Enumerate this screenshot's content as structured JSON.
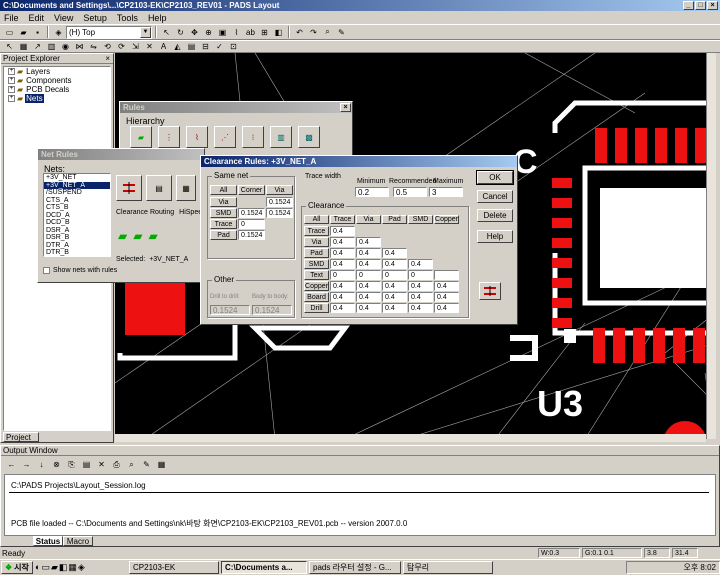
{
  "window": {
    "title": "C:\\Documents and Settings\\...\\CP2103-EK\\CP2103_REV01 - PADS Layout"
  },
  "menu": [
    "File",
    "Edit",
    "View",
    "Setup",
    "Tools",
    "Help"
  ],
  "toolbar": {
    "layer_value": "(H) Top"
  },
  "project_explorer": {
    "title": "Project Explorer",
    "items": [
      {
        "label": "Layers"
      },
      {
        "label": "Components"
      },
      {
        "label": "PCB Decals"
      },
      {
        "label": "Nets"
      }
    ],
    "tab": "Project"
  },
  "rules_window": {
    "title": "Rules",
    "hierarchy_label": "Hierarchy"
  },
  "net_rules": {
    "title": "Net Rules",
    "nets_label": "Nets:",
    "nets": [
      "+3V_NET",
      "+3V_NET_A",
      "/SUSPEND",
      "CTS_A",
      "CTS_B",
      "DCD_A",
      "DCD_B",
      "DSR_A",
      "DSR_B",
      "DTR_A",
      "DTR_B"
    ],
    "selected_index": 1,
    "buttons": [
      "Clearance",
      "Routing",
      "HiSpeed"
    ],
    "selected_label": "Selected:",
    "selected_value": "+3V_NET_A",
    "show_nets_label": "Show nets with rules"
  },
  "clearance": {
    "title": "Clearance Rules: +3V_NET_A",
    "same_net_label": "Same net",
    "same_net_cols": [
      "All",
      "Corner",
      "Via"
    ],
    "same_net_rows": [
      {
        "label": "Via",
        "values": [
          "",
          "0.1524"
        ]
      },
      {
        "label": "SMD",
        "values": [
          "0.1524",
          "0.1524"
        ]
      },
      {
        "label": "Trace",
        "values": [
          "0",
          ""
        ]
      },
      {
        "label": "Pad",
        "values": [
          "0.1524",
          ""
        ]
      }
    ],
    "other_label": "Other",
    "drill_to_drill_label": "Drill to drill:",
    "drill_to_drill_value": "0.1524",
    "body_to_body_label": "Body to body:",
    "body_to_body_value": "0.1524",
    "trace_width_label": "Trace width",
    "tw_headers": [
      "Minimum",
      "Recommended",
      "Maximum"
    ],
    "tw_values": [
      "0.2",
      "0.5",
      "3"
    ],
    "clearance_label": "Clearance",
    "grid_cols": [
      "All",
      "Trace",
      "Via",
      "Pad",
      "SMD",
      "Copper"
    ],
    "grid_rows": [
      {
        "label": "Trace",
        "values": [
          "0.4",
          "",
          "",
          "",
          ""
        ]
      },
      {
        "label": "Via",
        "values": [
          "0.4",
          "0.4",
          "",
          "",
          ""
        ]
      },
      {
        "label": "Pad",
        "values": [
          "0.4",
          "0.4",
          "0.4",
          "",
          ""
        ]
      },
      {
        "label": "SMD",
        "values": [
          "0.4",
          "0.4",
          "0.4",
          "0.4",
          ""
        ]
      },
      {
        "label": "Text",
        "values": [
          "0",
          "0",
          "0",
          "0",
          ""
        ]
      },
      {
        "label": "Copper",
        "values": [
          "0.4",
          "0.4",
          "0.4",
          "0.4",
          "0.4"
        ]
      },
      {
        "label": "Board",
        "values": [
          "0.4",
          "0.4",
          "0.4",
          "0.4",
          "0.4"
        ]
      },
      {
        "label": "Drill",
        "values": [
          "0.4",
          "0.4",
          "0.4",
          "0.4",
          "0.4"
        ]
      }
    ],
    "buttons": [
      "OK",
      "Cancel",
      "Delete",
      "Help"
    ]
  },
  "canvas": {
    "component_ref": "U3",
    "pin_label": "C"
  },
  "output": {
    "title": "Output Window",
    "lines": [
      "C:\\PADS Projects\\Layout_Session.log",
      "PCB file loaded -- C:\\Documents and Settings\\nk\\바탕 화면\\CP2103-EK\\CP2103_REV01.pcb -- version 2007.0.0"
    ],
    "tabs": [
      "Status",
      "Macro"
    ]
  },
  "status": {
    "left": "Ready",
    "w": "W:0.3",
    "g": "G:0.1 0.1",
    "x": "3.8",
    "y": "31.4"
  },
  "taskbar": {
    "start": "시작",
    "tasks": [
      "CP2103-EK",
      "C:\\Documents a...",
      "pads 라우터 설정 - G...",
      "탐무리"
    ],
    "clock": "오후 8:02"
  },
  "colors": {
    "copper": "#ee1111",
    "silk": "#ffffff",
    "bg": "#000000",
    "title": "#0a246a"
  }
}
